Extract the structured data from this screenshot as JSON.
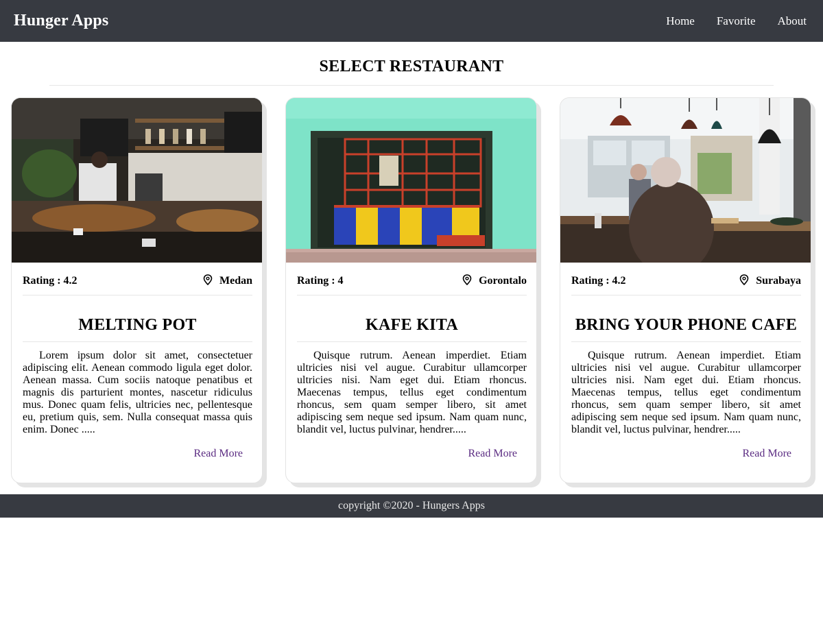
{
  "navbar": {
    "brand": "Hunger Apps",
    "links": [
      "Home",
      "Favorite",
      "About"
    ]
  },
  "section": {
    "title": "SELECT RESTAURANT"
  },
  "restaurants": [
    {
      "rating": "Rating : 4.2",
      "city": "Medan",
      "name": "MELTING POT",
      "description": "Lorem ipsum dolor sit amet, consectetuer adipiscing elit. Aenean commodo ligula eget dolor. Aenean massa. Cum sociis natoque penatibus et magnis dis parturient montes, nascetur ridiculus mus. Donec quam felis, ultricies nec, pellentesque eu, pretium quis, sem. Nulla consequat massa quis enim. Donec .....",
      "read_more": "Read More",
      "image": "cafe-counter-photo"
    },
    {
      "rating": "Rating : 4",
      "city": "Gorontalo",
      "name": "KAFE KITA",
      "description": "Quisque rutrum. Aenean imperdiet. Etiam ultricies nisi vel augue. Curabitur ullamcorper ultricies nisi. Nam eget dui. Etiam rhoncus. Maecenas tempus, tellus eget condimentum rhoncus, sem quam semper libero, sit amet adipiscing sem neque sed ipsum. Nam quam nunc, blandit vel, luctus pulvinar, hendrer.....",
      "read_more": "Read More",
      "image": "colorful-storefront-photo"
    },
    {
      "rating": "Rating : 4.2",
      "city": "Surabaya",
      "name": "BRING YOUR PHONE CAFE",
      "description": "Quisque rutrum. Aenean imperdiet. Etiam ultricies nisi vel augue. Curabitur ullamcorper ultricies nisi. Nam eget dui. Etiam rhoncus. Maecenas tempus, tellus eget condimentum rhoncus, sem quam semper libero, sit amet adipiscing sem neque sed ipsum. Nam quam nunc, blandit vel, luctus pulvinar, hendrer.....",
      "read_more": "Read More",
      "image": "cafe-interior-photo"
    }
  ],
  "footer": {
    "text": "copyright ©2020 - Hungers Apps"
  },
  "colors": {
    "navbar_bg": "#373a41",
    "link_color": "#5b2c82",
    "card_border": "#e3e3e3"
  },
  "icons": {
    "location": "map-pin-icon"
  }
}
